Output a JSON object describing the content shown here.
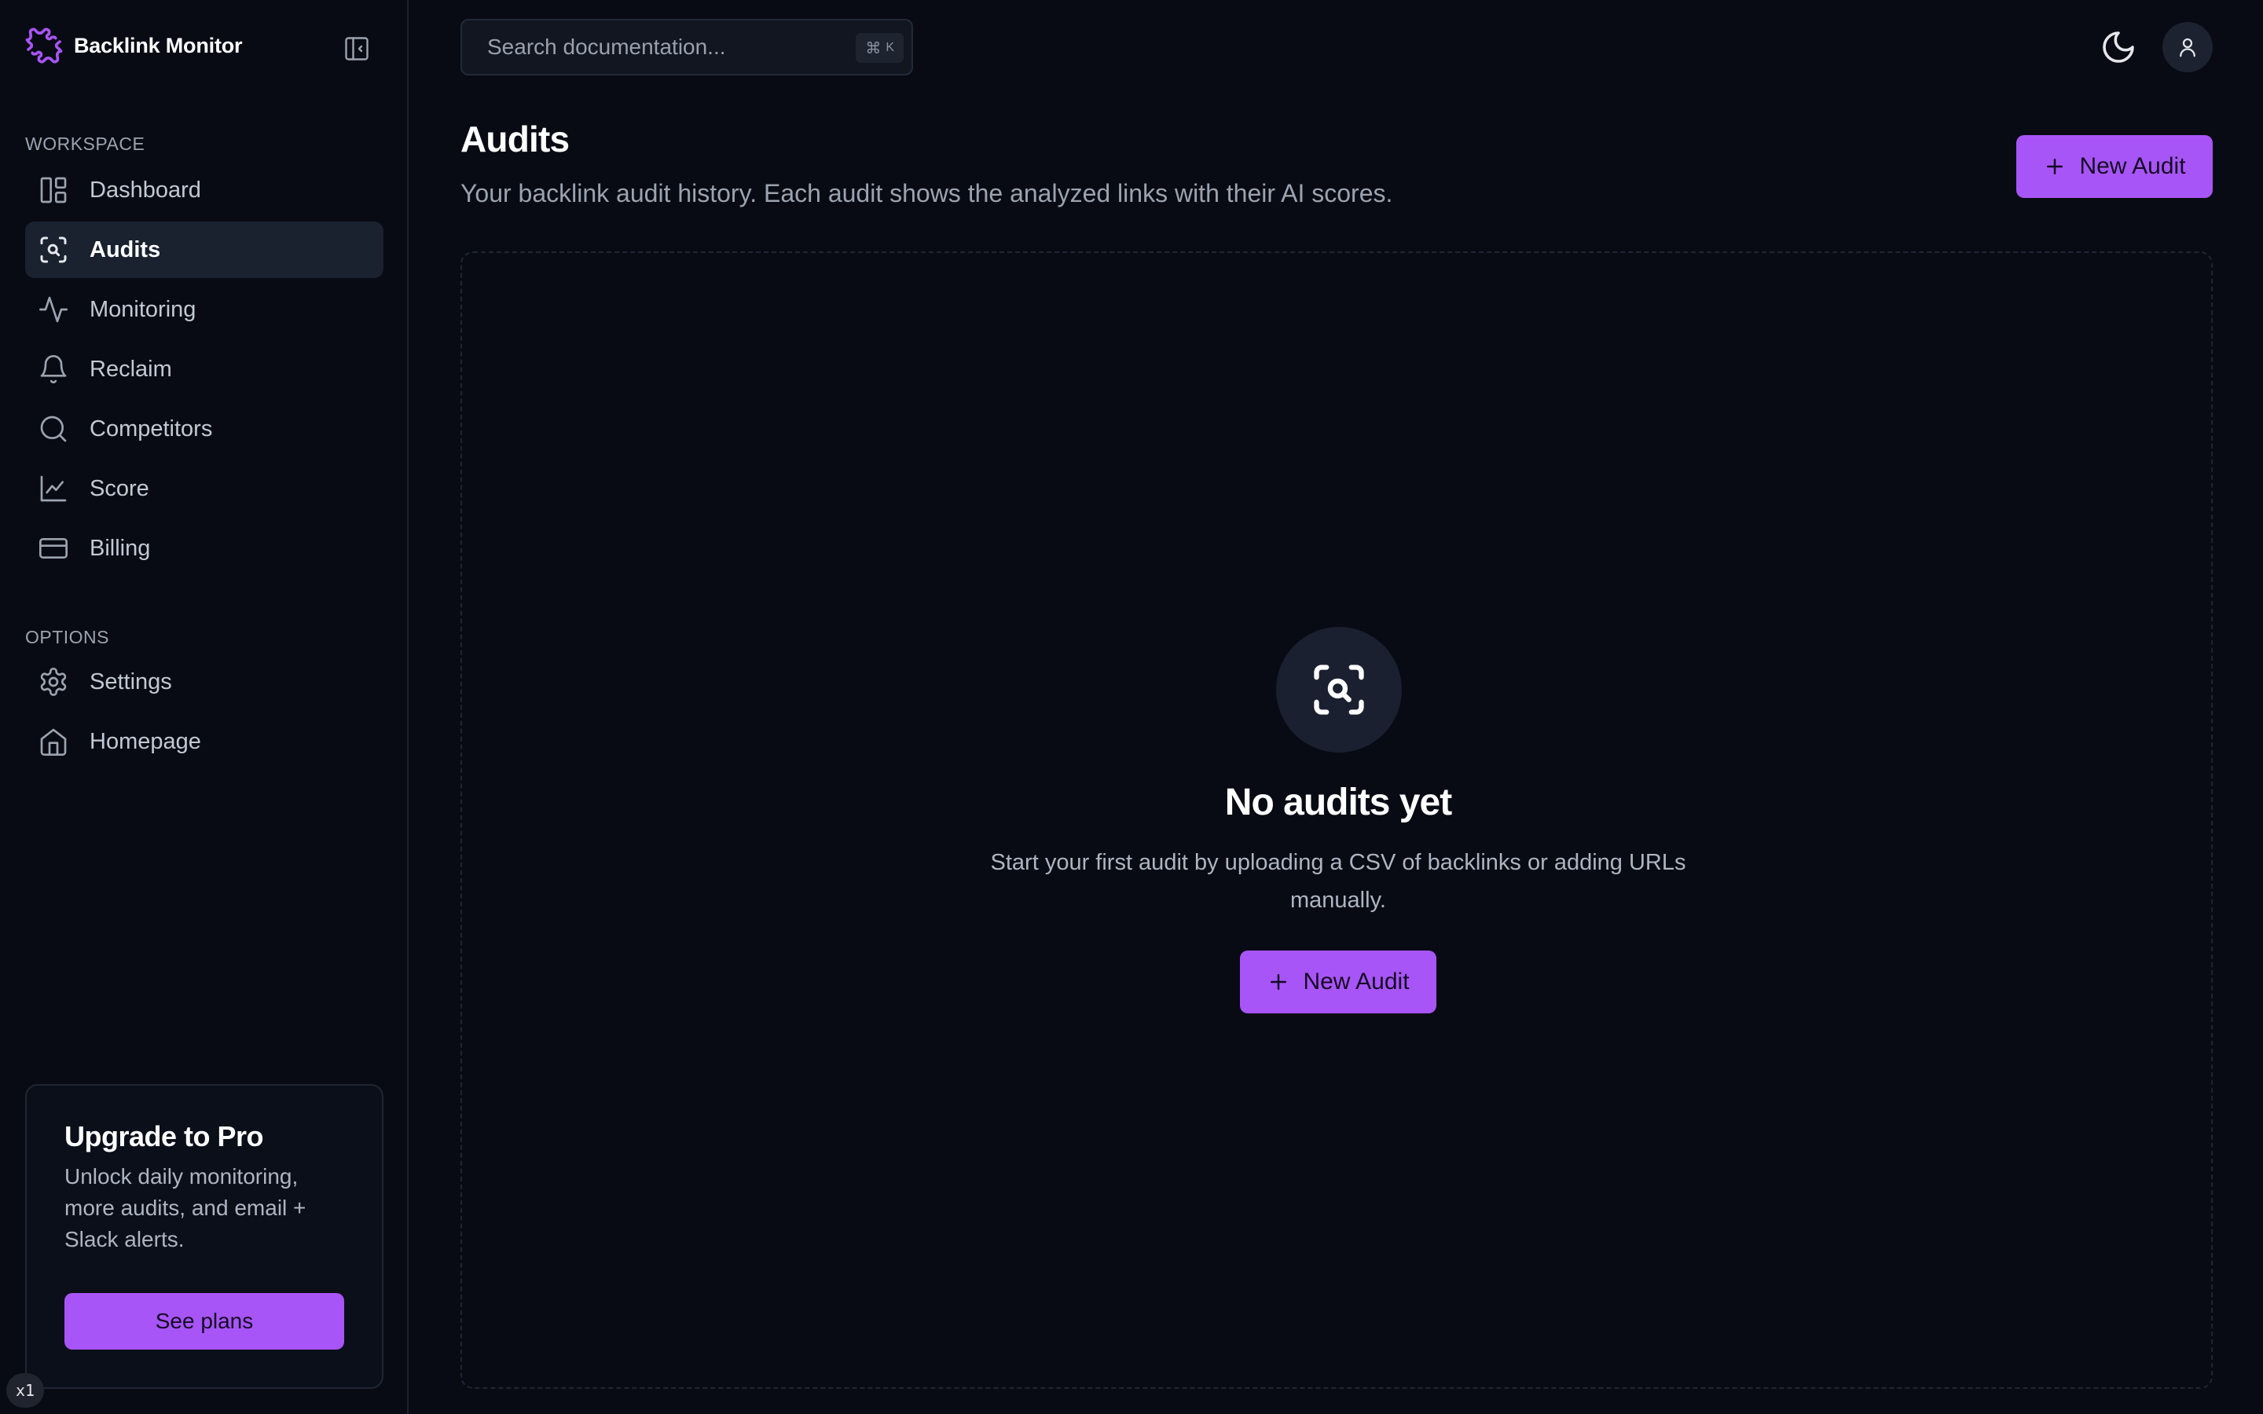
{
  "brand": {
    "name": "Backlink Monitor",
    "logo_icon": "puzzle-icon"
  },
  "colors": {
    "accent": "#a855f7",
    "background": "#080b14",
    "surface": "#1a2230"
  },
  "sidebar": {
    "workspace_label": "WORKSPACE",
    "workspace_items": [
      {
        "label": "Dashboard",
        "icon": "dashboard-icon",
        "active": false
      },
      {
        "label": "Audits",
        "icon": "scan-search-icon",
        "active": true
      },
      {
        "label": "Monitoring",
        "icon": "activity-icon",
        "active": false
      },
      {
        "label": "Reclaim",
        "icon": "bell-icon",
        "active": false
      },
      {
        "label": "Competitors",
        "icon": "search-icon",
        "active": false
      },
      {
        "label": "Score",
        "icon": "line-chart-icon",
        "active": false
      },
      {
        "label": "Billing",
        "icon": "credit-card-icon",
        "active": false
      }
    ],
    "options_label": "OPTIONS",
    "options_items": [
      {
        "label": "Settings",
        "icon": "gear-icon",
        "active": false
      },
      {
        "label": "Homepage",
        "icon": "home-icon",
        "active": false
      }
    ],
    "upgrade": {
      "title": "Upgrade to Pro",
      "text": "Unlock daily monitoring, more audits, and email + Slack alerts.",
      "button": "See plans"
    },
    "zoom_badge": "x1"
  },
  "topbar": {
    "search_placeholder": "Search documentation...",
    "shortcut_symbol": "⌘",
    "shortcut_key": "K"
  },
  "main": {
    "title": "Audits",
    "subtitle": "Your backlink audit history. Each audit shows the analyzed links with their AI scores.",
    "new_audit_button": "New Audit",
    "empty_state": {
      "title": "No audits yet",
      "text": "Start your first audit by uploading a CSV of backlinks or adding URLs manually.",
      "button": "New Audit"
    }
  }
}
